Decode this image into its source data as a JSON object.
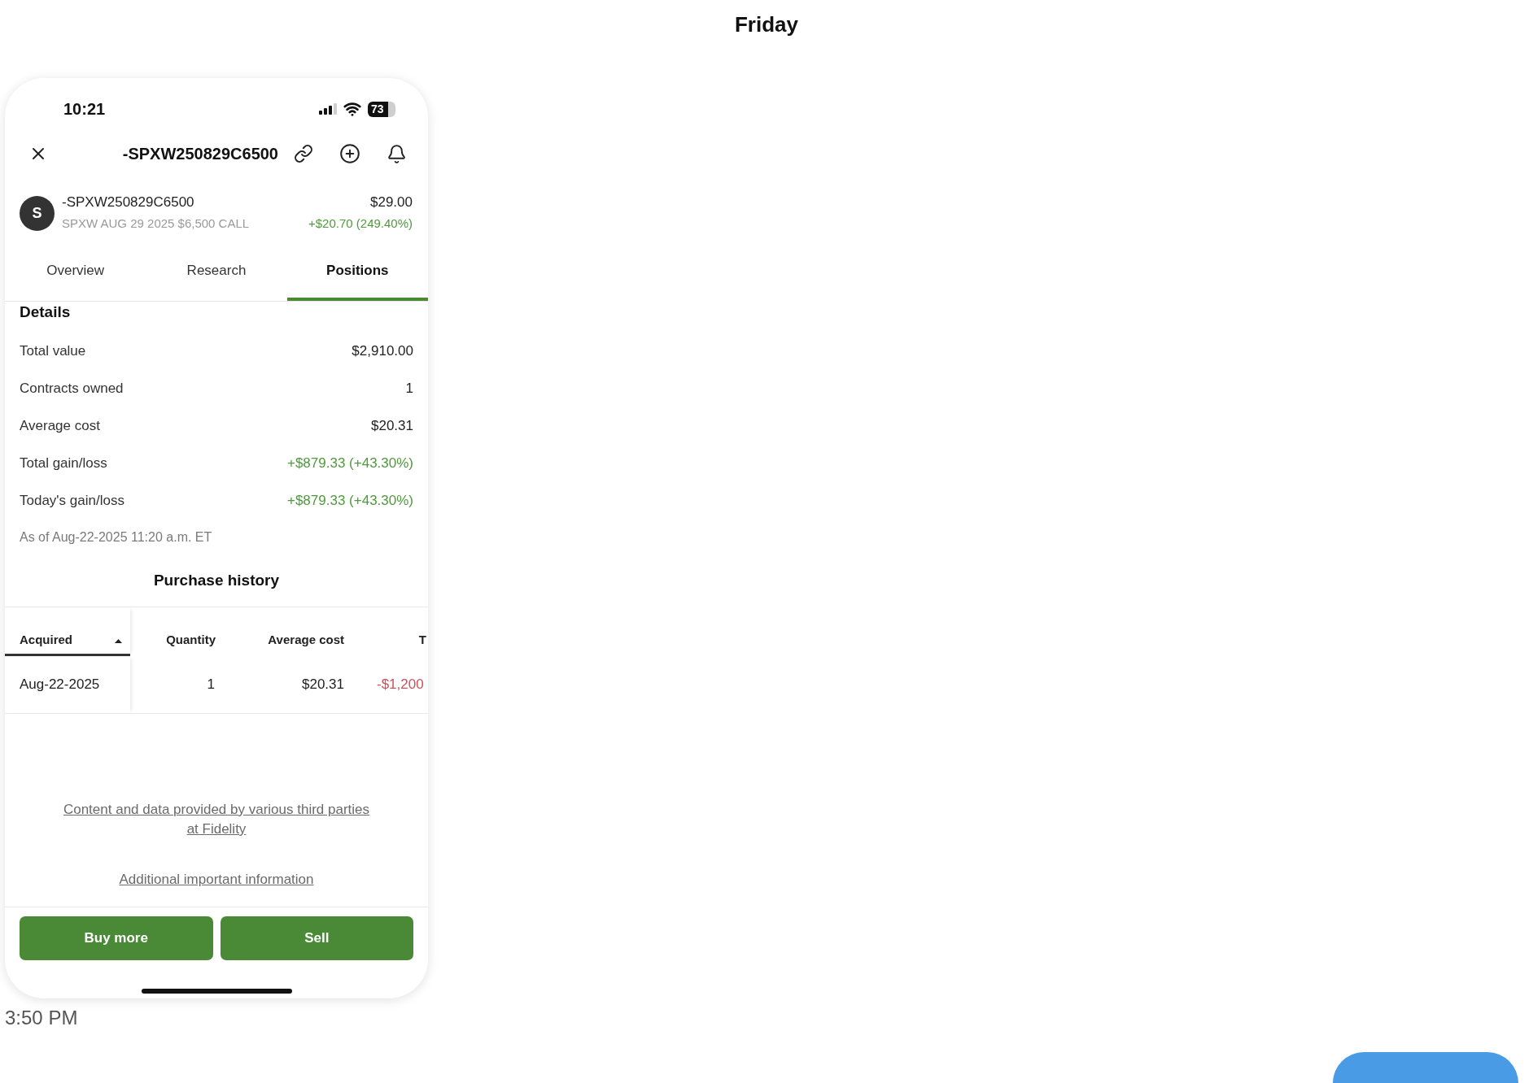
{
  "day_header": "Friday",
  "phone": {
    "status_bar": {
      "time": "10:21",
      "battery": "73"
    },
    "nav": {
      "title": "-SPXW250829C6500"
    },
    "quote": {
      "avatar": "S",
      "symbol": "-SPXW250829C6500",
      "description": "SPXW AUG 29 2025 $6,500 CALL",
      "price": "$29.00",
      "change": "+$20.70 (249.40%)"
    },
    "tabs": [
      {
        "label": "Overview",
        "selected": false
      },
      {
        "label": "Research",
        "selected": false
      },
      {
        "label": "Positions",
        "selected": true
      }
    ],
    "details": {
      "title": "Details",
      "rows": [
        {
          "label": "Total value",
          "value": "$2,910.00",
          "color": "#222222"
        },
        {
          "label": "Contracts owned",
          "value": "1",
          "color": "#222222"
        },
        {
          "label": "Average cost",
          "value": "$20.31",
          "color": "#222222"
        },
        {
          "label": "Total gain/loss",
          "value": "+$879.33 (+43.30%)",
          "color": "#4f9a3c"
        },
        {
          "label": "Today's gain/loss",
          "value": "+$879.33 (+43.30%)",
          "color": "#4f9a3c"
        }
      ],
      "as_of": "As of Aug-22-2025 11:20 a.m. ET"
    },
    "purchase_history": {
      "title": "Purchase history",
      "columns": [
        {
          "label": "Acquired",
          "sorted": true
        },
        {
          "label": "Quantity",
          "sorted": false
        },
        {
          "label": "Average cost",
          "sorted": false
        },
        {
          "label": "T",
          "sorted": false
        }
      ],
      "rows": [
        {
          "cells": [
            {
              "text": "Aug-22-2025",
              "color": "#222222"
            },
            {
              "text": "1",
              "color": "#222222"
            },
            {
              "text": "$20.31",
              "color": "#222222"
            },
            {
              "text": "-$1,200",
              "color": "#d0505a"
            }
          ]
        }
      ]
    },
    "footer_links": [
      "Content and data provided by various third parties at Fidelity",
      "Additional important information"
    ],
    "buttons": [
      {
        "label": "Buy more"
      },
      {
        "label": "Sell"
      }
    ]
  },
  "timestamp": "3:50 PM"
}
